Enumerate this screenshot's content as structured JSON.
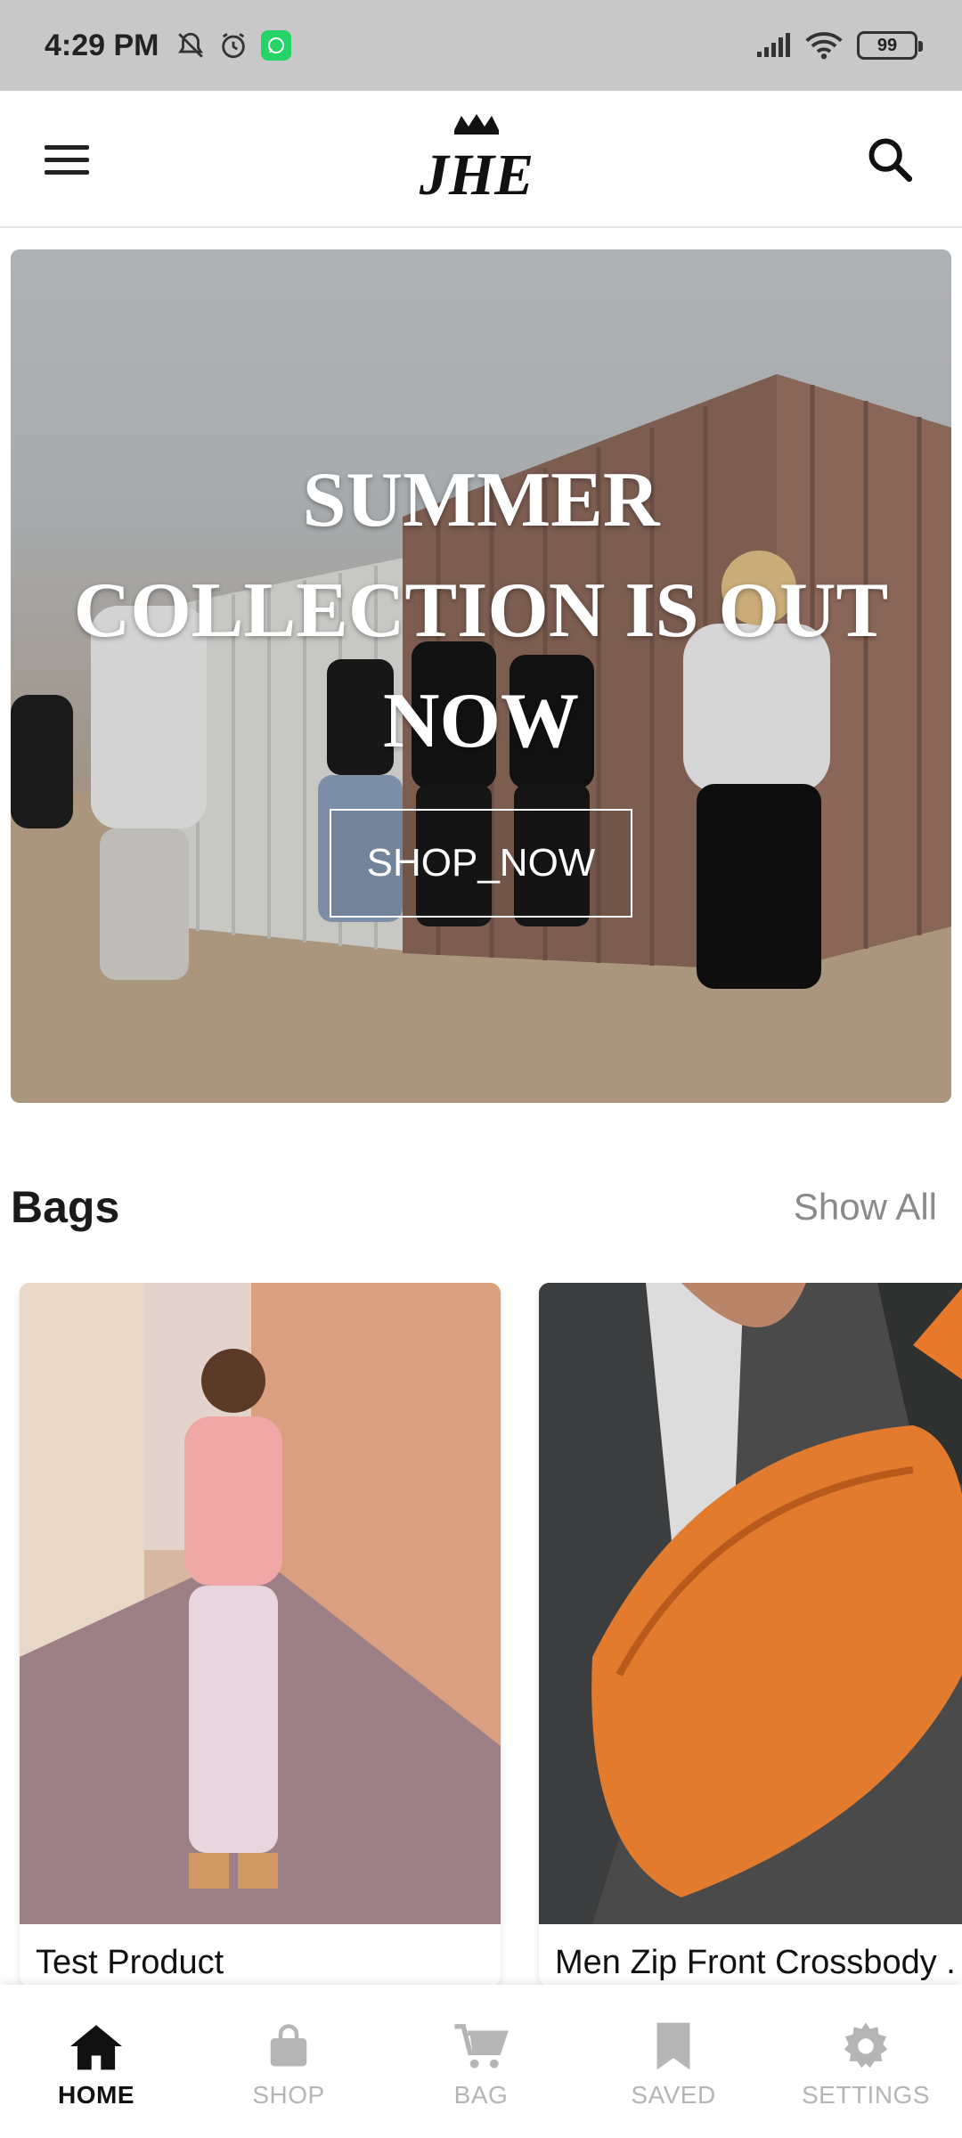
{
  "status_bar": {
    "time": "4:29 PM",
    "battery": "99",
    "icons": [
      "mute-bell-icon",
      "alarm-icon",
      "whatsapp-icon",
      "signal-icon",
      "wifi-icon",
      "battery-icon"
    ]
  },
  "header": {
    "logo_text": "JHE",
    "menu_icon": "hamburger-menu-icon",
    "search_icon": "search-icon"
  },
  "hero": {
    "title": "SUMMER COLLECTION IS OUT NOW",
    "cta_label": "SHOP_NOW"
  },
  "section": {
    "title": "Bags",
    "show_all": "Show All"
  },
  "products": [
    {
      "name": "Test Product"
    },
    {
      "name": "Men Zip Front Crossbody ."
    }
  ],
  "bottom_nav": {
    "items": [
      {
        "label": "HOME",
        "icon": "home-icon",
        "active": true
      },
      {
        "label": "SHOP",
        "icon": "shopping-bag-icon",
        "active": false
      },
      {
        "label": "BAG",
        "icon": "cart-icon",
        "active": false
      },
      {
        "label": "SAVED",
        "icon": "bookmark-icon",
        "active": false
      },
      {
        "label": "SETTINGS",
        "icon": "gear-icon",
        "active": false
      }
    ]
  },
  "colors": {
    "status_bar_bg": "#c8c8c8",
    "active_nav": "#111111",
    "inactive_nav": "#b5b5b5",
    "show_all": "#8a8a8a",
    "whatsapp": "#25d366"
  }
}
